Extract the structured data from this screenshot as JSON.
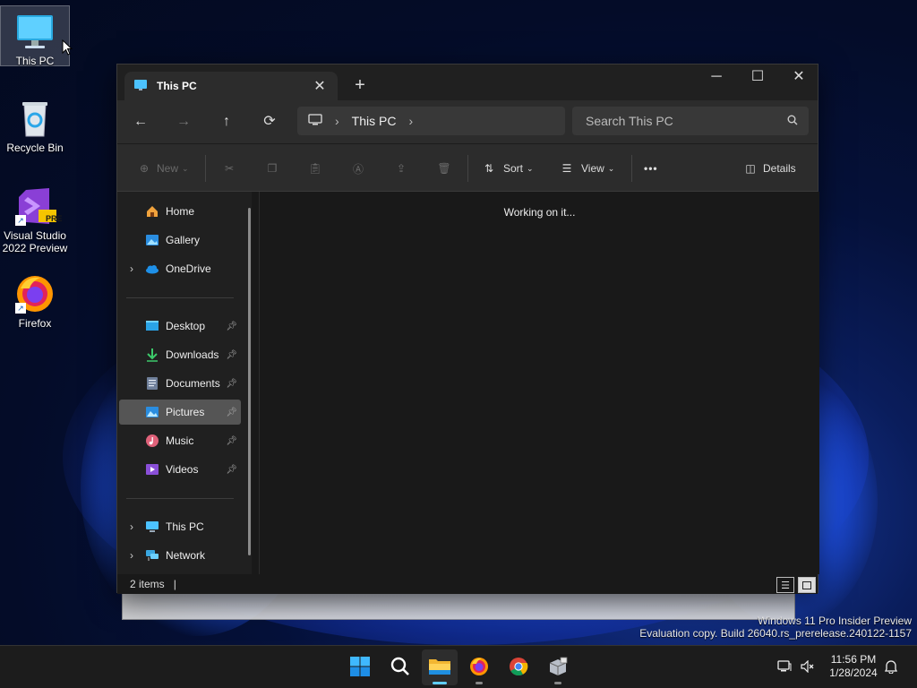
{
  "desktop": {
    "icons": [
      {
        "label": "This PC",
        "icon": "monitor-icon"
      },
      {
        "label": "Recycle Bin",
        "icon": "recycle-bin-icon"
      },
      {
        "label": "Visual Studio 2022 Preview",
        "label_line1": "Visual Studio",
        "label_line2": "2022 Preview",
        "badge": "PRE",
        "icon": "visual-studio-icon"
      },
      {
        "label": "Firefox",
        "icon": "firefox-icon"
      }
    ]
  },
  "window": {
    "tab_title": "This PC",
    "controls": {
      "minimize": "─",
      "maximize": "☐",
      "close": "✕"
    },
    "new_tab": "+",
    "address": {
      "crumb": "This PC"
    },
    "search": {
      "placeholder": "Search This PC"
    },
    "toolbar": {
      "new_label": "New",
      "sort_label": "Sort",
      "view_label": "View",
      "more_label": "•••",
      "details_label": "Details"
    },
    "sidebar": {
      "top": [
        {
          "label": "Home",
          "icon": "home-icon"
        },
        {
          "label": "Gallery",
          "icon": "gallery-icon"
        },
        {
          "label": "OneDrive",
          "icon": "cloud-icon",
          "expandable": true
        }
      ],
      "quick_access": [
        {
          "label": "Desktop",
          "icon": "desktop-folder-icon",
          "pinned": true
        },
        {
          "label": "Downloads",
          "icon": "download-icon",
          "pinned": true
        },
        {
          "label": "Documents",
          "icon": "documents-icon",
          "pinned": true
        },
        {
          "label": "Pictures",
          "icon": "pictures-icon",
          "pinned": true,
          "selected": true
        },
        {
          "label": "Music",
          "icon": "music-icon",
          "pinned": true
        },
        {
          "label": "Videos",
          "icon": "videos-icon",
          "pinned": true
        }
      ],
      "bottom": [
        {
          "label": "This PC",
          "icon": "monitor-icon",
          "expandable": true
        },
        {
          "label": "Network",
          "icon": "network-icon",
          "expandable": true
        }
      ]
    },
    "content": {
      "status_message": "Working on it..."
    },
    "statusbar": {
      "items_count": "2 items"
    }
  },
  "watermark": {
    "line1": "Windows 11 Pro Insider Preview",
    "line2": "Evaluation copy. Build 26040.rs_prerelease.240122-1157"
  },
  "taskbar": {
    "apps": [
      {
        "name": "start",
        "icon": "windows-logo-icon"
      },
      {
        "name": "search",
        "icon": "search-icon"
      },
      {
        "name": "file-explorer",
        "icon": "folder-icon",
        "active": true
      },
      {
        "name": "firefox",
        "icon": "firefox-icon",
        "running": true
      },
      {
        "name": "chrome",
        "icon": "chrome-icon"
      },
      {
        "name": "app-installer",
        "icon": "package-icon",
        "running": true
      }
    ],
    "clock": {
      "time": "11:56 PM",
      "date": "1/28/2024"
    }
  },
  "colors": {
    "accent": "#60cdff",
    "window_bg": "#191919",
    "toolbar_bg": "#2c2c2c"
  }
}
